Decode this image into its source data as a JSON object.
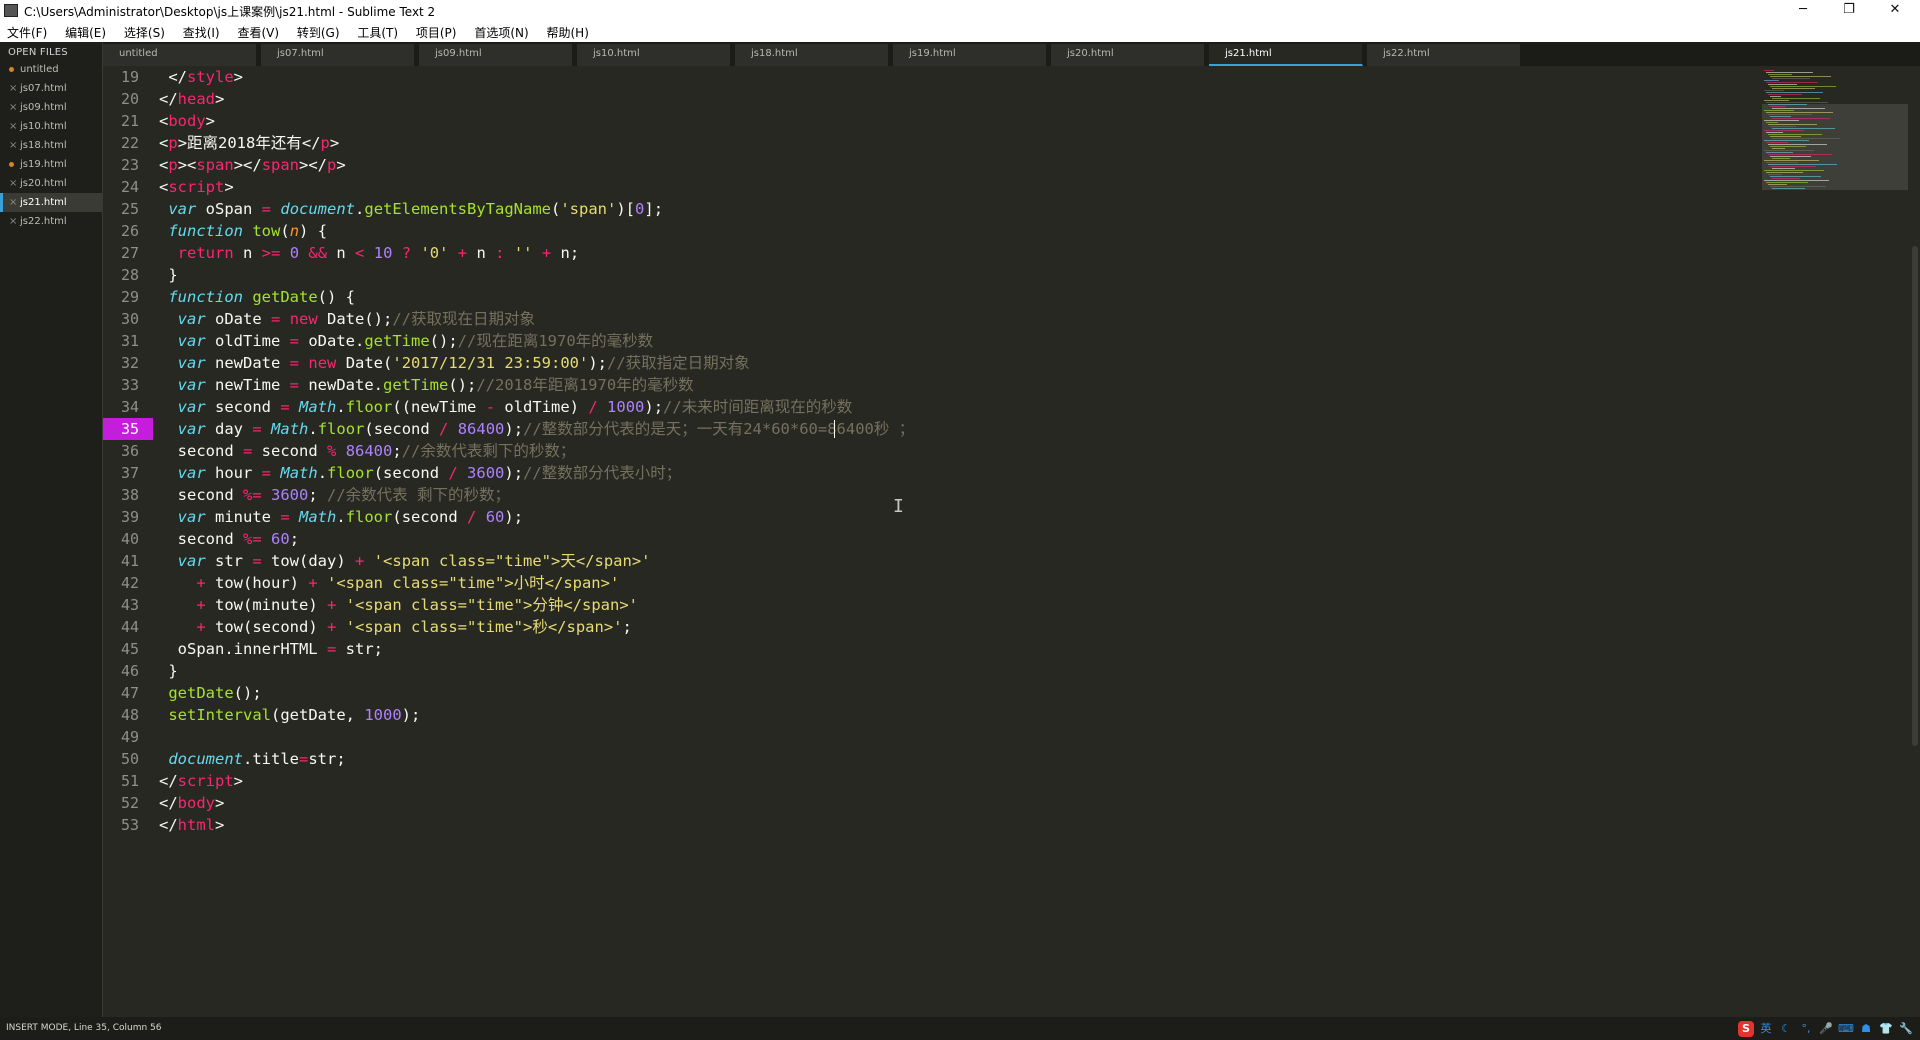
{
  "window": {
    "title": "C:\\Users\\Administrator\\Desktop\\js上课案例\\js21.html - Sublime Text 2",
    "minimize": "─",
    "restore": "❐",
    "close": "✕"
  },
  "menu": [
    "文件(F)",
    "编辑(E)",
    "选择(S)",
    "查找(I)",
    "查看(V)",
    "转到(G)",
    "工具(T)",
    "项目(P)",
    "首选项(N)",
    "帮助(H)"
  ],
  "sidebar": {
    "header": "OPEN FILES",
    "files": [
      {
        "name": "untitled",
        "marker": "dot"
      },
      {
        "name": "js07.html",
        "marker": "x"
      },
      {
        "name": "js09.html",
        "marker": "x"
      },
      {
        "name": "js10.html",
        "marker": "x"
      },
      {
        "name": "js18.html",
        "marker": "x"
      },
      {
        "name": "js19.html",
        "marker": "dot"
      },
      {
        "name": "js20.html",
        "marker": "x"
      },
      {
        "name": "js21.html",
        "marker": "x",
        "active": true
      },
      {
        "name": "js22.html",
        "marker": "x"
      }
    ]
  },
  "tabs": [
    "untitled",
    "js07.html",
    "js09.html",
    "js10.html",
    "js18.html",
    "js19.html",
    "js20.html",
    "js21.html",
    "js22.html"
  ],
  "active_tab": "js21.html",
  "editor": {
    "current_line": 35,
    "lines": [
      {
        "n": 19,
        "tokens": [
          [
            "",
            " </"
          ],
          [
            "tg",
            "style"
          ],
          [
            "",
            ">"
          ]
        ]
      },
      {
        "n": 20,
        "tokens": [
          [
            "",
            "</"
          ],
          [
            "tg",
            "head"
          ],
          [
            "",
            ">"
          ]
        ]
      },
      {
        "n": 21,
        "tokens": [
          [
            "",
            "<"
          ],
          [
            "tg",
            "body"
          ],
          [
            "",
            ">"
          ]
        ]
      },
      {
        "n": 22,
        "tokens": [
          [
            "",
            "<"
          ],
          [
            "tg",
            "p"
          ],
          [
            "",
            ">距离2018年还有</"
          ],
          [
            "tg",
            "p"
          ],
          [
            "",
            ">"
          ]
        ]
      },
      {
        "n": 23,
        "tokens": [
          [
            "",
            "<"
          ],
          [
            "tg",
            "p"
          ],
          [
            "",
            "><"
          ],
          [
            "tg",
            "span"
          ],
          [
            "",
            "></"
          ],
          [
            "tg",
            "span"
          ],
          [
            "",
            "></"
          ],
          [
            "tg",
            "p"
          ],
          [
            "",
            ">"
          ]
        ]
      },
      {
        "n": 24,
        "tokens": [
          [
            "",
            "<"
          ],
          [
            "tg",
            "script"
          ],
          [
            "",
            ">"
          ]
        ]
      },
      {
        "n": 25,
        "tokens": [
          [
            "",
            " "
          ],
          [
            "it",
            "var"
          ],
          [
            "",
            " oSpan "
          ],
          [
            "op",
            "="
          ],
          [
            "",
            " "
          ],
          [
            "it",
            "document"
          ],
          [
            "",
            "."
          ],
          [
            "fn",
            "getElementsByTagName"
          ],
          [
            "",
            "("
          ],
          [
            "st",
            "'span'"
          ],
          [
            "",
            ")["
          ],
          [
            "nu",
            "0"
          ],
          [
            "",
            "];"
          ]
        ]
      },
      {
        "n": 26,
        "tokens": [
          [
            "",
            " "
          ],
          [
            "it",
            "function"
          ],
          [
            "",
            " "
          ],
          [
            "fn",
            "tow"
          ],
          [
            "",
            "("
          ],
          [
            "pa",
            "n"
          ],
          [
            "",
            ") {"
          ]
        ]
      },
      {
        "n": 27,
        "tokens": [
          [
            "",
            "  "
          ],
          [
            "kw",
            "return"
          ],
          [
            "",
            " n "
          ],
          [
            "op",
            ">="
          ],
          [
            "",
            " "
          ],
          [
            "nu",
            "0"
          ],
          [
            "",
            " "
          ],
          [
            "op",
            "&&"
          ],
          [
            "",
            " n "
          ],
          [
            "op",
            "<"
          ],
          [
            "",
            " "
          ],
          [
            "nu",
            "10"
          ],
          [
            "",
            " "
          ],
          [
            "op",
            "?"
          ],
          [
            "",
            " "
          ],
          [
            "st",
            "'0'"
          ],
          [
            "",
            " "
          ],
          [
            "op",
            "+"
          ],
          [
            "",
            " n "
          ],
          [
            "op",
            ":"
          ],
          [
            "",
            " "
          ],
          [
            "st",
            "''"
          ],
          [
            "",
            " "
          ],
          [
            "op",
            "+"
          ],
          [
            "",
            " n;"
          ]
        ]
      },
      {
        "n": 28,
        "tokens": [
          [
            "",
            " }"
          ]
        ]
      },
      {
        "n": 29,
        "tokens": [
          [
            "",
            " "
          ],
          [
            "it",
            "function"
          ],
          [
            "",
            " "
          ],
          [
            "fn",
            "getDate"
          ],
          [
            "",
            "() {"
          ]
        ]
      },
      {
        "n": 30,
        "tokens": [
          [
            "",
            "  "
          ],
          [
            "it",
            "var"
          ],
          [
            "",
            " oDate "
          ],
          [
            "op",
            "="
          ],
          [
            "",
            " "
          ],
          [
            "kw",
            "new"
          ],
          [
            "",
            " Date();"
          ],
          [
            "cm",
            "//获取现在日期对象"
          ]
        ]
      },
      {
        "n": 31,
        "tokens": [
          [
            "",
            "  "
          ],
          [
            "it",
            "var"
          ],
          [
            "",
            " oldTime "
          ],
          [
            "op",
            "="
          ],
          [
            "",
            " oDate."
          ],
          [
            "fn",
            "getTime"
          ],
          [
            "",
            "();"
          ],
          [
            "cm",
            "//现在距离1970年的毫秒数"
          ]
        ]
      },
      {
        "n": 32,
        "tokens": [
          [
            "",
            "  "
          ],
          [
            "it",
            "var"
          ],
          [
            "",
            " newDate "
          ],
          [
            "op",
            "="
          ],
          [
            "",
            " "
          ],
          [
            "kw",
            "new"
          ],
          [
            "",
            " Date("
          ],
          [
            "st",
            "'2017/12/31 23:59:00'"
          ],
          [
            "",
            ");"
          ],
          [
            "cm",
            "//获取指定日期对象"
          ]
        ]
      },
      {
        "n": 33,
        "tokens": [
          [
            "",
            "  "
          ],
          [
            "it",
            "var"
          ],
          [
            "",
            " newTime "
          ],
          [
            "op",
            "="
          ],
          [
            "",
            " newDate."
          ],
          [
            "fn",
            "getTime"
          ],
          [
            "",
            "();"
          ],
          [
            "cm",
            "//2018年距离1970年的毫秒数"
          ]
        ]
      },
      {
        "n": 34,
        "tokens": [
          [
            "",
            "  "
          ],
          [
            "it",
            "var"
          ],
          [
            "",
            " second "
          ],
          [
            "op",
            "="
          ],
          [
            "",
            " "
          ],
          [
            "it",
            "Math"
          ],
          [
            "",
            "."
          ],
          [
            "fn",
            "floor"
          ],
          [
            "",
            "((newTime "
          ],
          [
            "op",
            "-"
          ],
          [
            "",
            " oldTime) "
          ],
          [
            "op",
            "/"
          ],
          [
            "",
            " "
          ],
          [
            "nu",
            "1000"
          ],
          [
            "",
            ");"
          ],
          [
            "cm",
            "//未来时间距离现在的秒数"
          ]
        ]
      },
      {
        "n": 35,
        "tokens": [
          [
            "",
            "  "
          ],
          [
            "it",
            "var"
          ],
          [
            "",
            " day "
          ],
          [
            "op",
            "="
          ],
          [
            "",
            " "
          ],
          [
            "it",
            "Math"
          ],
          [
            "",
            "."
          ],
          [
            "fn",
            "floor"
          ],
          [
            "",
            "(second "
          ],
          [
            "op",
            "/"
          ],
          [
            "",
            " "
          ],
          [
            "nu",
            "86400"
          ],
          [
            "",
            ");"
          ],
          [
            "cm",
            "//整数部分代表的是天；一天有24*60*60=86400秒 ；"
          ]
        ]
      },
      {
        "n": 36,
        "tokens": [
          [
            "",
            "  second "
          ],
          [
            "op",
            "="
          ],
          [
            "",
            " second "
          ],
          [
            "op",
            "%"
          ],
          [
            "",
            " "
          ],
          [
            "nu",
            "86400"
          ],
          [
            "",
            ";"
          ],
          [
            "cm",
            "//余数代表剩下的秒数；"
          ]
        ]
      },
      {
        "n": 37,
        "tokens": [
          [
            "",
            "  "
          ],
          [
            "it",
            "var"
          ],
          [
            "",
            " hour "
          ],
          [
            "op",
            "="
          ],
          [
            "",
            " "
          ],
          [
            "it",
            "Math"
          ],
          [
            "",
            "."
          ],
          [
            "fn",
            "floor"
          ],
          [
            "",
            "(second "
          ],
          [
            "op",
            "/"
          ],
          [
            "",
            " "
          ],
          [
            "nu",
            "3600"
          ],
          [
            "",
            ");"
          ],
          [
            "cm",
            "//整数部分代表小时；"
          ]
        ]
      },
      {
        "n": 38,
        "tokens": [
          [
            "",
            "  second "
          ],
          [
            "op",
            "%="
          ],
          [
            "",
            " "
          ],
          [
            "nu",
            "3600"
          ],
          [
            "",
            "; "
          ],
          [
            "cm",
            "//余数代表 剩下的秒数；"
          ]
        ]
      },
      {
        "n": 39,
        "tokens": [
          [
            "",
            "  "
          ],
          [
            "it",
            "var"
          ],
          [
            "",
            " minute "
          ],
          [
            "op",
            "="
          ],
          [
            "",
            " "
          ],
          [
            "it",
            "Math"
          ],
          [
            "",
            "."
          ],
          [
            "fn",
            "floor"
          ],
          [
            "",
            "(second "
          ],
          [
            "op",
            "/"
          ],
          [
            "",
            " "
          ],
          [
            "nu",
            "60"
          ],
          [
            "",
            ");"
          ]
        ]
      },
      {
        "n": 40,
        "tokens": [
          [
            "",
            "  second "
          ],
          [
            "op",
            "%="
          ],
          [
            "",
            " "
          ],
          [
            "nu",
            "60"
          ],
          [
            "",
            ";"
          ]
        ]
      },
      {
        "n": 41,
        "tokens": [
          [
            "",
            "  "
          ],
          [
            "it",
            "var"
          ],
          [
            "",
            " str "
          ],
          [
            "op",
            "="
          ],
          [
            "",
            " tow(day) "
          ],
          [
            "op",
            "+"
          ],
          [
            "",
            " "
          ],
          [
            "st",
            "'<span class=\"time\">天</span>'"
          ]
        ]
      },
      {
        "n": 42,
        "tokens": [
          [
            "",
            "    "
          ],
          [
            "op",
            "+"
          ],
          [
            "",
            " tow(hour) "
          ],
          [
            "op",
            "+"
          ],
          [
            "",
            " "
          ],
          [
            "st",
            "'<span class=\"time\">小时</span>'"
          ]
        ]
      },
      {
        "n": 43,
        "tokens": [
          [
            "",
            "    "
          ],
          [
            "op",
            "+"
          ],
          [
            "",
            " tow(minute) "
          ],
          [
            "op",
            "+"
          ],
          [
            "",
            " "
          ],
          [
            "st",
            "'<span class=\"time\">分钟</span>'"
          ]
        ]
      },
      {
        "n": 44,
        "tokens": [
          [
            "",
            "    "
          ],
          [
            "op",
            "+"
          ],
          [
            "",
            " tow(second) "
          ],
          [
            "op",
            "+"
          ],
          [
            "",
            " "
          ],
          [
            "st",
            "'<span class=\"time\">秒</span>'"
          ],
          [
            "",
            ";"
          ]
        ]
      },
      {
        "n": 45,
        "tokens": [
          [
            "",
            "  oSpan.innerHTML "
          ],
          [
            "op",
            "="
          ],
          [
            "",
            " str;"
          ]
        ]
      },
      {
        "n": 46,
        "tokens": [
          [
            "",
            " }"
          ]
        ]
      },
      {
        "n": 47,
        "tokens": [
          [
            "",
            " "
          ],
          [
            "fn",
            "getDate"
          ],
          [
            "",
            "();"
          ]
        ]
      },
      {
        "n": 48,
        "tokens": [
          [
            "",
            " "
          ],
          [
            "fn",
            "setInterval"
          ],
          [
            "",
            "(getDate, "
          ],
          [
            "nu",
            "1000"
          ],
          [
            "",
            ");"
          ]
        ]
      },
      {
        "n": 49,
        "tokens": [
          [
            "",
            ""
          ]
        ]
      },
      {
        "n": 50,
        "tokens": [
          [
            "",
            " "
          ],
          [
            "it",
            "document"
          ],
          [
            "",
            ".title"
          ],
          [
            "op",
            "="
          ],
          [
            "",
            "str;"
          ]
        ]
      },
      {
        "n": 51,
        "tokens": [
          [
            "",
            "</"
          ],
          [
            "tg",
            "script"
          ],
          [
            "",
            ">"
          ]
        ]
      },
      {
        "n": 52,
        "tokens": [
          [
            "",
            "</"
          ],
          [
            "tg",
            "body"
          ],
          [
            "",
            ">"
          ]
        ]
      },
      {
        "n": 53,
        "tokens": [
          [
            "",
            "</"
          ],
          [
            "tg",
            "html"
          ],
          [
            "",
            ">"
          ]
        ]
      }
    ]
  },
  "status": {
    "text": "INSERT MODE, Line 35, Column 56"
  },
  "tray": [
    "S",
    "英",
    "☾",
    "°,",
    "🎤",
    "⌨",
    "☗",
    "👕",
    "🔧"
  ],
  "colors": {
    "background": "#272822",
    "current_line_number": "#c61cdd",
    "accent": "#3aa0d8"
  }
}
